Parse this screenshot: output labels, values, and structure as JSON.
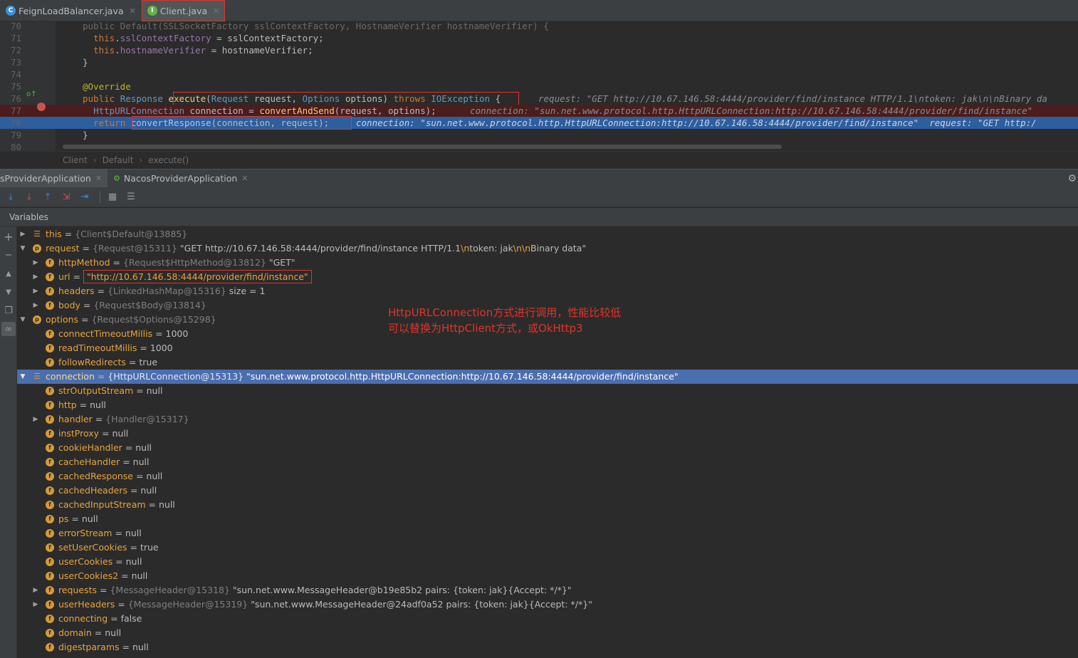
{
  "editor_tabs": [
    {
      "label": "FeignLoadBalancer.java",
      "icon": "class-c-icon",
      "active": false
    },
    {
      "label": "Client.java",
      "icon": "interface-i-icon",
      "active": true
    }
  ],
  "code": {
    "lines": [
      {
        "num": "70",
        "text": "  public Default(SSLSocketFactory sslContextFactory, HostnameVerifier hostnameVerifier) {"
      },
      {
        "num": "71",
        "text": "    this.sslContextFactory = sslContextFactory;"
      },
      {
        "num": "72",
        "text": "    this.hostnameVerifier = hostnameVerifier;"
      },
      {
        "num": "73",
        "text": "  }"
      },
      {
        "num": "74",
        "text": ""
      },
      {
        "num": "75",
        "text": "  @Override"
      },
      {
        "num": "76",
        "text": "  public Response execute(Request request, Options options) throws IOException {"
      },
      {
        "num": "77",
        "text": "    HttpURLConnection connection = convertAndSend(request, options);"
      },
      {
        "num": "78",
        "text": "    return convertResponse(connection, request);"
      },
      {
        "num": "79",
        "text": "  }"
      },
      {
        "num": "80",
        "text": ""
      }
    ],
    "inline_76": "request: \"GET http://10.67.146.58:4444/provider/find/instance HTTP/1.1\\ntoken: jak\\n\\nBinary da",
    "inline_77": "connection: \"sun.net.www.protocol.http.HttpURLConnection:http://10.67.146.58:4444/provider/find/instance\"",
    "inline_78": "connection: \"sun.net.www.protocol.http.HttpURLConnection:http://10.67.146.58:4444/provider/find/instance\"  request: \"GET http:/"
  },
  "breadcrumb": [
    "Client",
    "Default",
    "execute()"
  ],
  "debug_tabs": [
    {
      "label": "sProviderApplication",
      "active": true
    },
    {
      "label": "NacosProviderApplication",
      "active": false
    }
  ],
  "variables_title": "Variables",
  "variables": [
    {
      "depth": 0,
      "arrow": "right",
      "icon": "list",
      "name": "this",
      "type": "{Client$Default@13885}",
      "value": ""
    },
    {
      "depth": 0,
      "arrow": "down",
      "icon": "p",
      "name": "request",
      "type": "{Request@15311}",
      "value": "\"GET http://10.67.146.58:4444/provider/find/instance HTTP/1.1\\ntoken: jak\\n\\nBinary data\""
    },
    {
      "depth": 1,
      "arrow": "right",
      "icon": "f",
      "name": "httpMethod",
      "type": "{Request$HttpMethod@13812}",
      "value": "\"GET\""
    },
    {
      "depth": 1,
      "arrow": "right",
      "icon": "f",
      "name": "url",
      "type": "",
      "value": "\"http://10.67.146.58:4444/provider/find/instance\"",
      "string": true,
      "boxed": true
    },
    {
      "depth": 1,
      "arrow": "right",
      "icon": "f",
      "name": "headers",
      "type": "{LinkedHashMap@15316}",
      "value": " size = 1"
    },
    {
      "depth": 1,
      "arrow": "right",
      "icon": "f",
      "name": "body",
      "type": "{Request$Body@13814}",
      "value": ""
    },
    {
      "depth": 0,
      "arrow": "down",
      "icon": "p",
      "name": "options",
      "type": "{Request$Options@15298}",
      "value": ""
    },
    {
      "depth": 1,
      "arrow": "",
      "icon": "f",
      "name": "connectTimeoutMillis",
      "type": "",
      "value": "1000"
    },
    {
      "depth": 1,
      "arrow": "",
      "icon": "f",
      "name": "readTimeoutMillis",
      "type": "",
      "value": "1000"
    },
    {
      "depth": 1,
      "arrow": "",
      "icon": "f",
      "name": "followRedirects",
      "type": "",
      "value": "true"
    },
    {
      "depth": 0,
      "arrow": "down",
      "icon": "list",
      "name": "connection",
      "type": "{HttpURLConnection@15313}",
      "value": "\"sun.net.www.protocol.http.HttpURLConnection:http://10.67.146.58:4444/provider/find/instance\"",
      "selected": true
    },
    {
      "depth": 1,
      "arrow": "",
      "icon": "f",
      "name": "strOutputStream",
      "type": "",
      "value": "null"
    },
    {
      "depth": 1,
      "arrow": "",
      "icon": "f",
      "name": "http",
      "type": "",
      "value": "null"
    },
    {
      "depth": 1,
      "arrow": "right",
      "icon": "f",
      "name": "handler",
      "type": "{Handler@15317}",
      "value": ""
    },
    {
      "depth": 1,
      "arrow": "",
      "icon": "f",
      "name": "instProxy",
      "type": "",
      "value": "null"
    },
    {
      "depth": 1,
      "arrow": "",
      "icon": "f",
      "name": "cookieHandler",
      "type": "",
      "value": "null"
    },
    {
      "depth": 1,
      "arrow": "",
      "icon": "f",
      "name": "cacheHandler",
      "type": "",
      "value": "null"
    },
    {
      "depth": 1,
      "arrow": "",
      "icon": "f",
      "name": "cachedResponse",
      "type": "",
      "value": "null"
    },
    {
      "depth": 1,
      "arrow": "",
      "icon": "f",
      "name": "cachedHeaders",
      "type": "",
      "value": "null"
    },
    {
      "depth": 1,
      "arrow": "",
      "icon": "f",
      "name": "cachedInputStream",
      "type": "",
      "value": "null"
    },
    {
      "depth": 1,
      "arrow": "",
      "icon": "f",
      "name": "ps",
      "type": "",
      "value": "null"
    },
    {
      "depth": 1,
      "arrow": "",
      "icon": "f",
      "name": "errorStream",
      "type": "",
      "value": "null"
    },
    {
      "depth": 1,
      "arrow": "",
      "icon": "f",
      "name": "setUserCookies",
      "type": "",
      "value": "true"
    },
    {
      "depth": 1,
      "arrow": "",
      "icon": "f",
      "name": "userCookies",
      "type": "",
      "value": "null"
    },
    {
      "depth": 1,
      "arrow": "",
      "icon": "f",
      "name": "userCookies2",
      "type": "",
      "value": "null"
    },
    {
      "depth": 1,
      "arrow": "right",
      "icon": "f",
      "name": "requests",
      "type": "{MessageHeader@15318}",
      "value": "\"sun.net.www.MessageHeader@b19e85b2 pairs: {token: jak}{Accept: */*}\""
    },
    {
      "depth": 1,
      "arrow": "right",
      "icon": "f",
      "name": "userHeaders",
      "type": "{MessageHeader@15319}",
      "value": "\"sun.net.www.MessageHeader@24adf0a52 pairs: {token: jak}{Accept: */*}\""
    },
    {
      "depth": 1,
      "arrow": "",
      "icon": "f",
      "name": "connecting",
      "type": "",
      "value": "false"
    },
    {
      "depth": 1,
      "arrow": "",
      "icon": "f",
      "name": "domain",
      "type": "",
      "value": "null"
    },
    {
      "depth": 1,
      "arrow": "",
      "icon": "f",
      "name": "digestparams",
      "type": "",
      "value": "null"
    }
  ],
  "annotation": {
    "line1": "HttpURLConnection方式进行调用，性能比较低",
    "line2": "可以替换为HttpClient方式，或OkHttp3"
  },
  "colors": {
    "highlight_box": "#e0342a",
    "selection": "#4b6eaf",
    "current_line": "#2d5e9e",
    "field_name": "#e8a33d"
  }
}
